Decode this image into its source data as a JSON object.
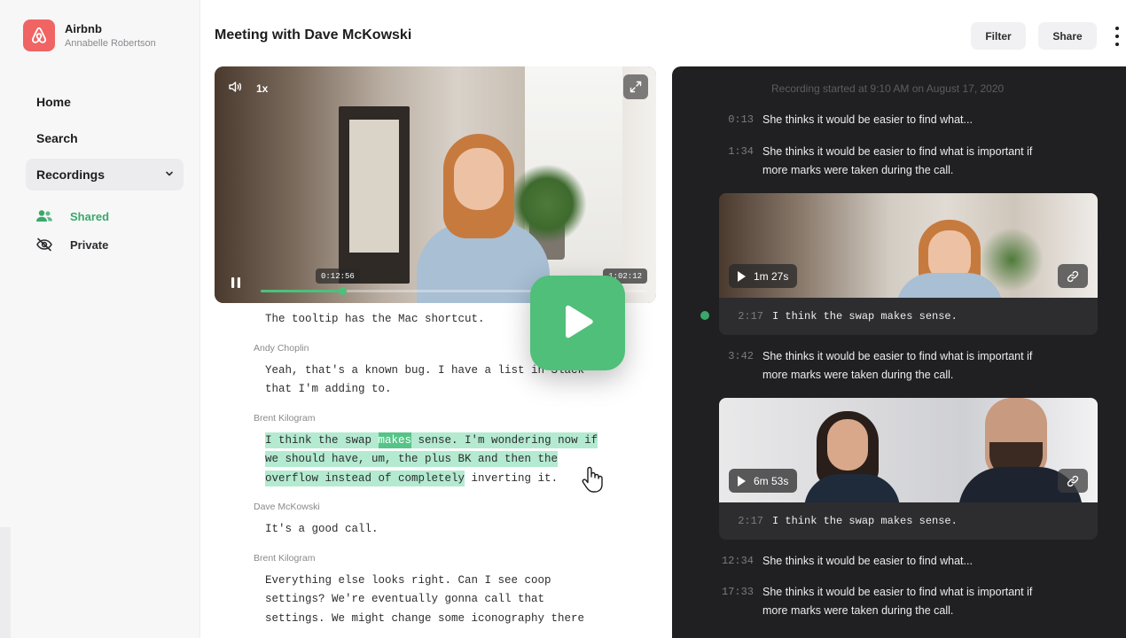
{
  "brand": {
    "name": "Airbnb",
    "user": "Annabelle Robertson",
    "logo_color": "#f06464"
  },
  "nav": {
    "home": "Home",
    "search": "Search",
    "recordings": "Recordings",
    "shared": "Shared",
    "private": "Private"
  },
  "header": {
    "title": "Meeting with Dave McKowski",
    "filter": "Filter",
    "share": "Share"
  },
  "player": {
    "speed": "1x",
    "current_time": "0:12:56",
    "total_time": "1:02:12",
    "progress_fraction": 0.21
  },
  "transcript": {
    "intro": "The tooltip has the Mac shortcut.",
    "blocks": [
      {
        "speaker": "Andy Choplin",
        "lines": [
          "Yeah, that's a known bug. I have a list in Slack",
          "that I'm adding to."
        ]
      },
      {
        "speaker": "Brent Kilogram",
        "hl_1a": "I think the swap ",
        "hl_1b": "makes",
        "hl_1c": " sense. I'm wondering now if",
        "hl_2": "we should have, um, the plus BK and then the",
        "hl_3a": "overflow instead of completely",
        "hl_3b": " inverting it."
      },
      {
        "speaker": "Dave McKowski",
        "lines": [
          "It's a good call."
        ]
      },
      {
        "speaker": "Brent Kilogram",
        "lines": [
          "Everything else looks right. Can I see coop",
          "settings? We're eventually gonna call that",
          "settings. We might change some iconography there"
        ]
      }
    ]
  },
  "panel": {
    "recording_started": "Recording started at 9:10 AM on August 17, 2020",
    "items": [
      {
        "time": "0:13",
        "text": "She thinks it would be easier to find what..."
      },
      {
        "time": "1:34",
        "text1": "She thinks it would be easier to find what is important if",
        "text2": "more marks were taken during the call."
      },
      {
        "time": "3:42",
        "text1": "She thinks it would be easier to find what is important if",
        "text2": "more marks were taken during the call."
      },
      {
        "time": "12:34",
        "text": "She thinks it would be easier to find what..."
      },
      {
        "time": "17:33",
        "text1": "She thinks it would be easier to find what is important if",
        "text2": "more marks were taken during the call."
      }
    ],
    "cards": [
      {
        "duration": "1m 27s",
        "time": "2:17",
        "text": "I think the swap makes sense."
      },
      {
        "duration": "6m 53s",
        "time": "2:17",
        "text": "I think the swap makes sense."
      }
    ]
  },
  "colors": {
    "accent": "#4fbf79",
    "shared_green": "#3aa86b",
    "highlight": "#b3ead0",
    "panel_bg": "#202022"
  }
}
